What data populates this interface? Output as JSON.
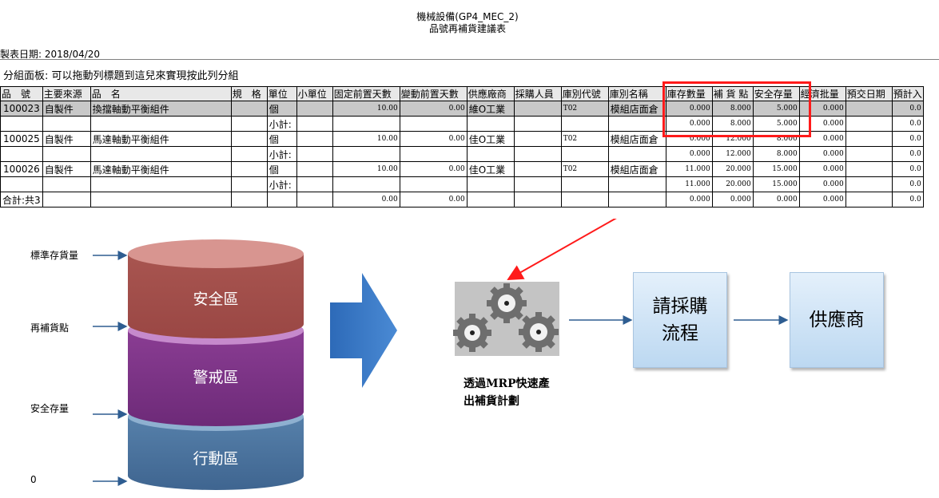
{
  "report": {
    "title_line1": "機械設備(GP4_MEC_2)",
    "title_line2": "品號再補貨建議表",
    "date": "製表日期: 2018/04/20",
    "group_panel": "分組面板: 可以拖動列標題到這兒來實現按此列分組"
  },
  "table": {
    "headers": [
      "品　號",
      "主要來源",
      "品　名",
      "規　格",
      "單位",
      "小單位",
      "固定前置天數",
      "變動前置天數",
      "供應廠商",
      "採購人員",
      "庫別代號",
      "庫別名稱",
      "庫存數量",
      "補 貨 點",
      "安全存量",
      "經濟批量",
      "預交日期",
      "預計入"
    ],
    "rows": [
      {
        "item_no": "100023",
        "source": "自製件",
        "name": "換擋軸動平衡組件",
        "spec": "",
        "unit": "個",
        "subunit": "",
        "fixed_lead": "10.00",
        "var_lead": "0.00",
        "supplier": "維O工業",
        "buyer": "",
        "wh_code": "T02",
        "wh_name": "模組店面倉",
        "stock": "0.000",
        "reorder": "8.000",
        "safety": "5.000",
        "eoq": "0.000",
        "due": "",
        "expected": "0.0"
      },
      {
        "item_no": "",
        "source": "",
        "name": "",
        "spec": "",
        "unit": "小計:",
        "subunit": "",
        "fixed_lead": "",
        "var_lead": "",
        "supplier": "",
        "buyer": "",
        "wh_code": "",
        "wh_name": "",
        "stock": "0.000",
        "reorder": "8.000",
        "safety": "5.000",
        "eoq": "0.000",
        "due": "",
        "expected": "0.0"
      },
      {
        "item_no": "100025",
        "source": "自製件",
        "name": "馬達軸動平衡組件",
        "spec": "",
        "unit": "個",
        "subunit": "",
        "fixed_lead": "10.00",
        "var_lead": "0.00",
        "supplier": "佳O工業",
        "buyer": "",
        "wh_code": "T02",
        "wh_name": "模組店面倉",
        "stock": "0.000",
        "reorder": "12.000",
        "safety": "8.000",
        "eoq": "0.000",
        "due": "",
        "expected": "0.0"
      },
      {
        "item_no": "",
        "source": "",
        "name": "",
        "spec": "",
        "unit": "小計:",
        "subunit": "",
        "fixed_lead": "",
        "var_lead": "",
        "supplier": "",
        "buyer": "",
        "wh_code": "",
        "wh_name": "",
        "stock": "0.000",
        "reorder": "12.000",
        "safety": "8.000",
        "eoq": "0.000",
        "due": "",
        "expected": "0.0"
      },
      {
        "item_no": "100026",
        "source": "自製件",
        "name": "馬達軸動平衡組件",
        "spec": "",
        "unit": "個",
        "subunit": "",
        "fixed_lead": "10.00",
        "var_lead": "0.00",
        "supplier": "佳O工業",
        "buyer": "",
        "wh_code": "T02",
        "wh_name": "模組店面倉",
        "stock": "11.000",
        "reorder": "20.000",
        "safety": "15.000",
        "eoq": "0.000",
        "due": "",
        "expected": "0.0"
      },
      {
        "item_no": "",
        "source": "",
        "name": "",
        "spec": "",
        "unit": "小計:",
        "subunit": "",
        "fixed_lead": "",
        "var_lead": "",
        "supplier": "",
        "buyer": "",
        "wh_code": "",
        "wh_name": "",
        "stock": "11.000",
        "reorder": "20.000",
        "safety": "15.000",
        "eoq": "0.000",
        "due": "",
        "expected": "0.0"
      },
      {
        "item_no": "合計:共3",
        "source": "",
        "name": "",
        "spec": "",
        "unit": "",
        "subunit": "",
        "fixed_lead": "0.00",
        "var_lead": "0.00",
        "supplier": "",
        "buyer": "",
        "wh_code": "",
        "wh_name": "",
        "stock": "0.000",
        "reorder": "0.000",
        "safety": "0.000",
        "eoq": "0.000",
        "due": "",
        "expected": "0.0"
      }
    ]
  },
  "stock_levels": {
    "label_standard": "標準存貨量",
    "label_reorder": "再補貨點",
    "label_safety": "安全存量",
    "label_zero": "0",
    "zone_safe": "安全區",
    "zone_warning": "警戒區",
    "zone_action": "行動區"
  },
  "flow": {
    "mrp_caption": "透過MRP快速產出補貨計劃",
    "purchase_process": "請採購流程",
    "supplier": "供應商"
  },
  "colors": {
    "highlight_box": "#ff1a1a",
    "zone_safe": "#a04d48",
    "zone_warning": "#7a3183",
    "zone_action": "#4c7299",
    "big_arrow": "#3a78c4",
    "flow_box": "#cfe3f6"
  }
}
